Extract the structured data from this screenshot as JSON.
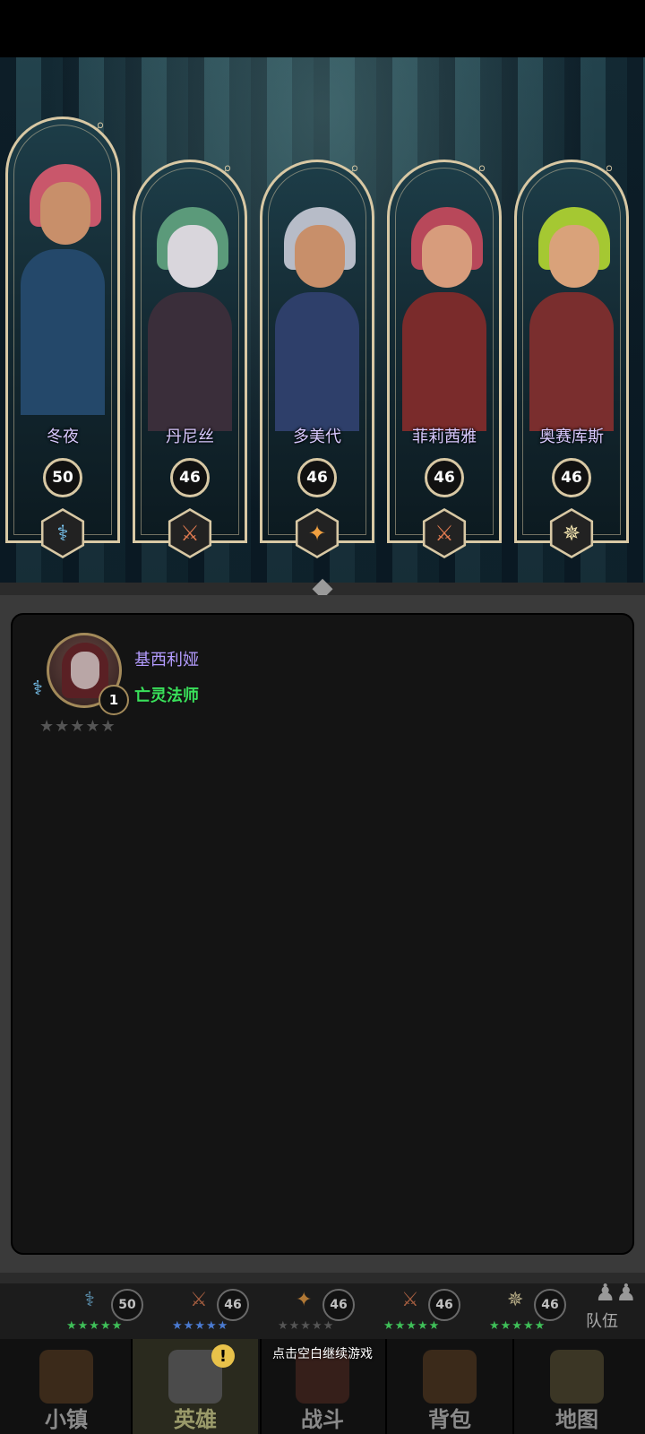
{
  "heroes": [
    {
      "name": "冬夜",
      "level": "50",
      "class_icon": "staff-icon",
      "hair": "#c9576b",
      "body": "#24486a",
      "skin": "#c88f6a"
    },
    {
      "name": "丹尼丝",
      "level": "46",
      "class_icon": "sword-icon",
      "hair": "#5b9a7a",
      "body": "#3a2e3a",
      "skin": "#d9d6dc"
    },
    {
      "name": "多美代",
      "level": "46",
      "class_icon": "holy-star-icon",
      "hair": "#b7bcc8",
      "body": "#2e3f6a",
      "skin": "#c88f6a"
    },
    {
      "name": "菲莉茜雅",
      "level": "46",
      "class_icon": "sword-icon",
      "hair": "#b8485a",
      "body": "#7a2b2b",
      "skin": "#d79c7c"
    },
    {
      "name": "奥赛库斯",
      "level": "46",
      "class_icon": "compass-star-icon",
      "hair": "#a5c832",
      "body": "#7a2e2e",
      "skin": "#d9a27a"
    }
  ],
  "recruit": {
    "name": "基西利娅",
    "class_name": "亡灵法师",
    "level": "1",
    "stars": "★★★★★"
  },
  "team": [
    {
      "level": "50",
      "stars": "★★★★★"
    },
    {
      "level": "46",
      "stars": "★★★★★"
    },
    {
      "level": "46",
      "stars": "★★★★★"
    },
    {
      "level": "46",
      "stars": "★★★★★"
    },
    {
      "level": "46",
      "stars": "★★★★★"
    }
  ],
  "team_label": "队伍",
  "continue_hint": "点击空白继续游戏",
  "nav": [
    {
      "label": "小镇",
      "icon": "town-icon"
    },
    {
      "label": "英雄",
      "icon": "hero-icon",
      "notification": "!"
    },
    {
      "label": "战斗",
      "icon": "battle-icon"
    },
    {
      "label": "背包",
      "icon": "backpack-icon"
    },
    {
      "label": "地图",
      "icon": "map-icon"
    }
  ]
}
